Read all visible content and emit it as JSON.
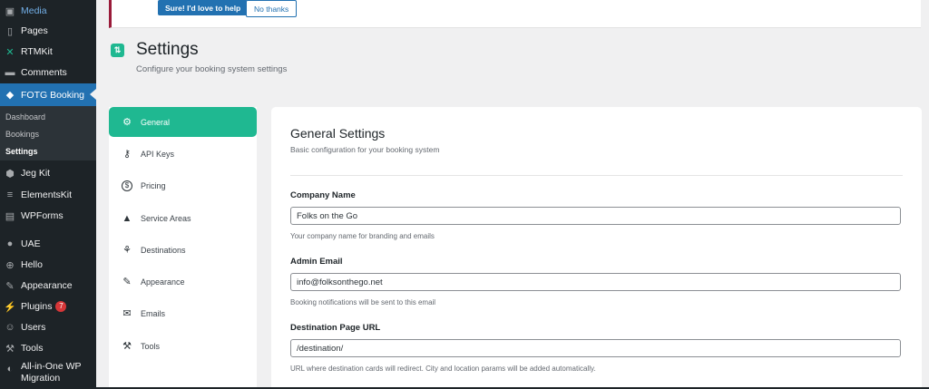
{
  "sidebar": {
    "items": [
      {
        "label": "Media",
        "icon": "media-icon",
        "glyph": "▣"
      },
      {
        "label": "Pages",
        "icon": "pages-icon",
        "glyph": "▯"
      },
      {
        "label": "RTMKit",
        "icon": "rtmkit-icon",
        "glyph": "✕"
      },
      {
        "label": "Comments",
        "icon": "comments-icon",
        "glyph": "▬"
      },
      {
        "label": "FOTG Booking",
        "icon": "car-icon",
        "glyph": "◆"
      },
      {
        "label": "Jeg Kit",
        "icon": "jegkit-icon",
        "glyph": "⬢"
      },
      {
        "label": "ElementsKit",
        "icon": "elementskit-icon",
        "glyph": "≡"
      },
      {
        "label": "WPForms",
        "icon": "wpforms-icon",
        "glyph": "▤"
      },
      {
        "label": "UAE",
        "icon": "uae-icon",
        "glyph": "●"
      },
      {
        "label": "Hello",
        "icon": "hello-icon",
        "glyph": "⊕"
      },
      {
        "label": "Appearance",
        "icon": "appearance-icon",
        "glyph": "✎"
      },
      {
        "label": "Plugins",
        "icon": "plugins-icon",
        "glyph": "⚡",
        "badge": "7"
      },
      {
        "label": "Users",
        "icon": "users-icon",
        "glyph": "☺"
      },
      {
        "label": "Tools",
        "icon": "tools-icon",
        "glyph": "⚒"
      },
      {
        "label": "All-in-One WP Migration",
        "icon": "migration-icon",
        "glyph": "◐"
      }
    ],
    "submenu": {
      "dashboard": "Dashboard",
      "bookings": "Bookings",
      "settings": "Settings"
    }
  },
  "notice": {
    "accept_label": "Sure! I'd love to help",
    "decline_label": "No thanks"
  },
  "page": {
    "title": "Settings",
    "subtitle": "Configure your booking system settings"
  },
  "tabs": [
    {
      "label": "General",
      "icon": "gear-icon",
      "glyph": "⚙"
    },
    {
      "label": "API Keys",
      "icon": "key-icon",
      "glyph": "⚷"
    },
    {
      "label": "Pricing",
      "icon": "dollar-icon",
      "glyph": "$"
    },
    {
      "label": "Service Areas",
      "icon": "map-icon",
      "glyph": "▲"
    },
    {
      "label": "Destinations",
      "icon": "palm-tree-icon",
      "glyph": "⚘"
    },
    {
      "label": "Appearance",
      "icon": "brush-icon",
      "glyph": "✎"
    },
    {
      "label": "Emails",
      "icon": "envelope-icon",
      "glyph": "✉"
    },
    {
      "label": "Tools",
      "icon": "wrench-icon",
      "glyph": "⚒"
    }
  ],
  "general": {
    "title": "General Settings",
    "description": "Basic configuration for your booking system",
    "fields": {
      "company_name": {
        "label": "Company Name",
        "value": "Folks on the Go",
        "help": "Your company name for branding and emails"
      },
      "admin_email": {
        "label": "Admin Email",
        "value": "info@folksonthego.net",
        "help": "Booking notifications will be sent to this email"
      },
      "destination_url": {
        "label": "Destination Page URL",
        "value": "/destination/",
        "help": "URL where destination cards will redirect. City and location params will be added automatically."
      }
    }
  },
  "colors": {
    "accent": "#1fb891",
    "wp_blue": "#2271b1",
    "sidebar_bg": "#1d2327"
  }
}
